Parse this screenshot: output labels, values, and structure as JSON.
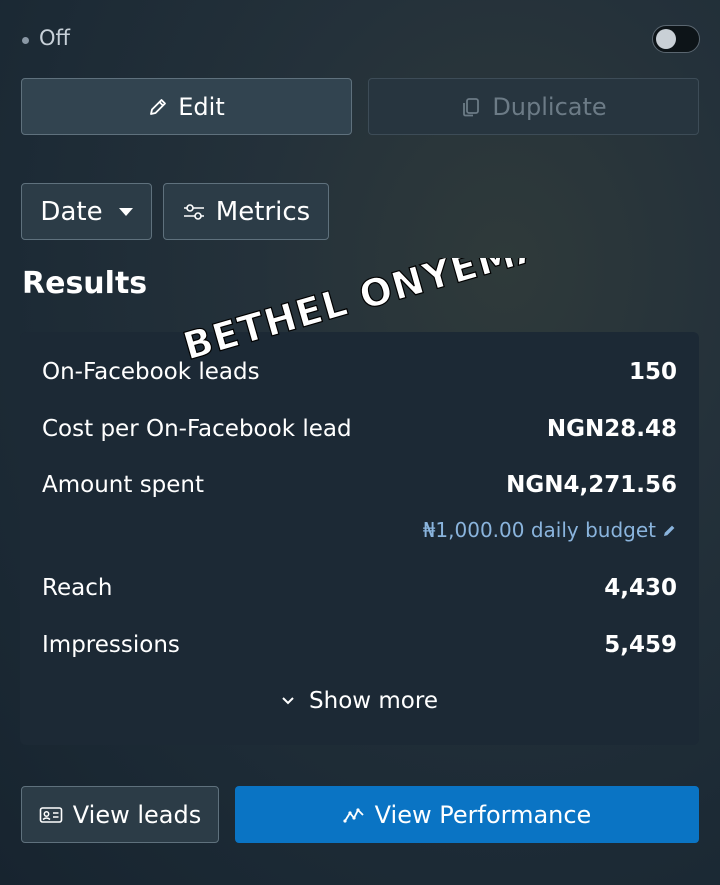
{
  "status": {
    "label": "Off",
    "toggle_on": false
  },
  "actions": {
    "edit_label": "Edit",
    "duplicate_label": "Duplicate"
  },
  "filters": {
    "date_label": "Date",
    "metrics_label": "Metrics"
  },
  "results": {
    "title": "Results",
    "rows": [
      {
        "label": "On-Facebook leads",
        "value": "150"
      },
      {
        "label": "Cost per On-Facebook lead",
        "value": "NGN28.48"
      },
      {
        "label": "Amount spent",
        "value": "NGN4,271.56"
      },
      {
        "label": "Reach",
        "value": "4,430"
      },
      {
        "label": "Impressions",
        "value": "5,459"
      }
    ],
    "budget_text": "₦1,000.00 daily budget",
    "show_more_label": "Show more"
  },
  "footer": {
    "view_leads_label": "View leads",
    "view_performance_label": "View Performance"
  },
  "watermark": {
    "text": "BETHEL ONYEMA"
  },
  "colors": {
    "primary": "#0a74c4",
    "budget_link": "#8ab4dd"
  },
  "icons": [
    "pencil-icon",
    "duplicate-icon",
    "caret-down-icon",
    "sliders-icon",
    "chevron-down-icon",
    "pencil-small-icon",
    "id-card-icon",
    "trend-line-icon"
  ]
}
